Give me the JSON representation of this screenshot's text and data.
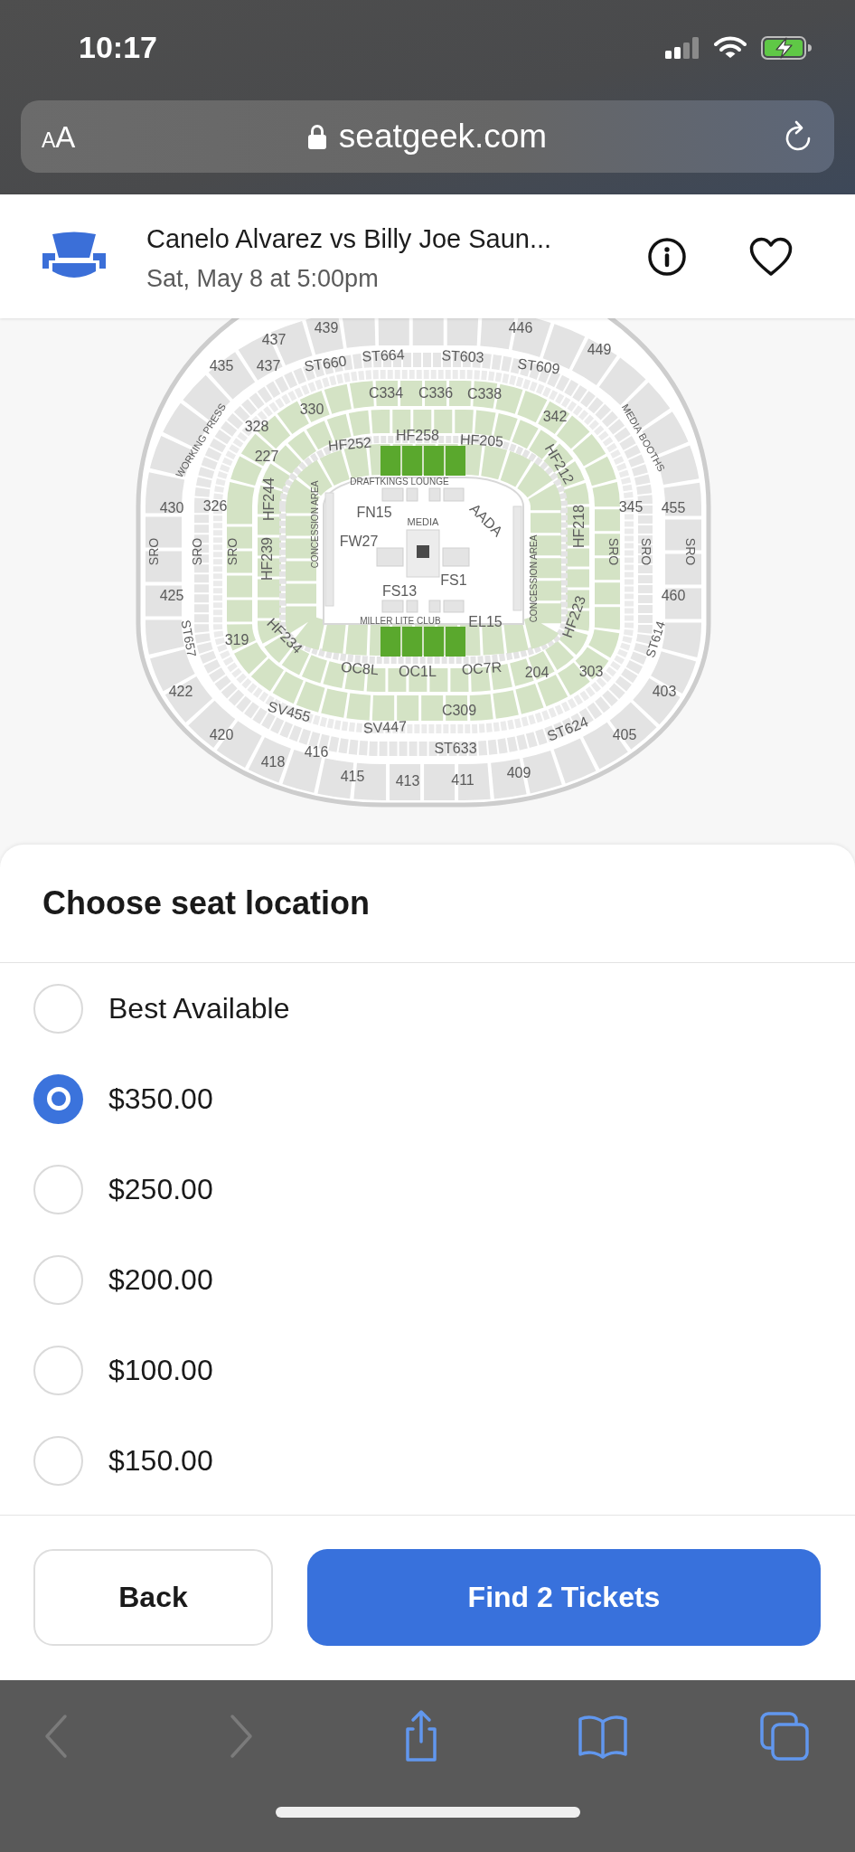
{
  "status_bar": {
    "time": "10:17"
  },
  "browser": {
    "text_size_button": "AA",
    "url": "seatgeek.com"
  },
  "event": {
    "title": "Canelo Alvarez vs Billy Joe Saun...",
    "date": "Sat, May 8 at 5:00pm",
    "favorited": false
  },
  "map": {
    "labels": [
      "439",
      "446",
      "437",
      "449",
      "435",
      "437",
      "ST660",
      "ST664",
      "ST603",
      "ST609",
      "C334",
      "C336",
      "C338",
      "330",
      "342",
      "328",
      "WORKING PRESS",
      "MEDIA BOOTHS",
      "HF252",
      "HF258",
      "HF205",
      "HF212",
      "227",
      "DRAFTKINGS LOUNGE",
      "430",
      "326",
      "FN15",
      "MEDIA",
      "AADA",
      "345",
      "455",
      "HF244",
      "CONCESSION AREA",
      "FW27",
      "SRO",
      "SRO",
      "SRO",
      "HF239",
      "HF218",
      "SRO",
      "SRO",
      "SRO",
      "CONCESSION AREA",
      "425",
      "460",
      "FS1",
      "FS13",
      "MILLER LITE CLUB",
      "EL15",
      "HF223",
      "ST657",
      "319",
      "HF234",
      "ST614",
      "OC8L",
      "OC1L",
      "OC7R",
      "204",
      "303",
      "422",
      "403",
      "SV455",
      "C309",
      "SV447",
      "420",
      "ST624",
      "405",
      "ST633",
      "416",
      "418",
      "415",
      "413",
      "411",
      "409"
    ]
  },
  "seat_picker": {
    "title": "Choose seat location",
    "options": [
      {
        "label": "Best Available",
        "selected": false
      },
      {
        "label": "$350.00",
        "selected": true
      },
      {
        "label": "$250.00",
        "selected": false
      },
      {
        "label": "$200.00",
        "selected": false
      },
      {
        "label": "$100.00",
        "selected": false
      },
      {
        "label": "$150.00",
        "selected": false
      }
    ]
  },
  "buttons": [
    {
      "label": "Back",
      "kind": "secondary"
    },
    {
      "label": "Find 2 Tickets",
      "kind": "primary"
    }
  ],
  "toolbar": {
    "items": [
      {
        "kind": "back",
        "disabled": true
      },
      {
        "kind": "forward",
        "disabled": true
      },
      {
        "kind": "share",
        "disabled": false
      },
      {
        "kind": "bookmarks",
        "disabled": false
      },
      {
        "kind": "tabs",
        "disabled": false
      }
    ]
  }
}
